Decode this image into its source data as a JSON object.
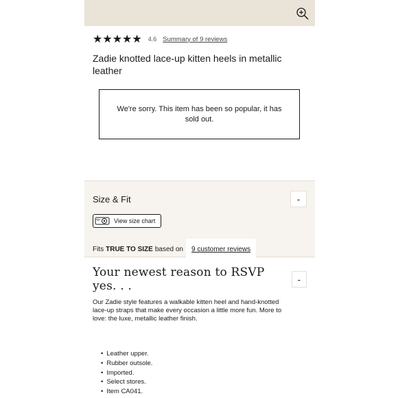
{
  "header": {
    "zoom_icon": "zoom-in-icon"
  },
  "rating": {
    "stars": "★★★★★",
    "value": "4.6",
    "summary_link": "Summary of 9 reviews"
  },
  "product": {
    "title": "Zadie knotted lace-up kitten heels in metallic leather",
    "soldout_message": "We're sorry. This item has been so popular, it has sold out."
  },
  "size_fit": {
    "title": "Size & Fit",
    "toggle": "-",
    "size_chart_label": "View size chart",
    "fits_prefix": "Fits",
    "fits_value": "TRUE TO SIZE",
    "fits_middle": "based on",
    "reviews_link": "9 customer reviews"
  },
  "description": {
    "title": "Your newest reason to RSVP yes. . .",
    "toggle": "-",
    "body": "Our Zadie style features a walkable kitten heel and hand-knotted lace-up straps that make every occasion a little more fun. More to love: the luxe, metallic leather finish.",
    "bullets": [
      "Leather upper.",
      "Rubber outsole.",
      "Imported.",
      "Select stores.",
      "Item CA041."
    ]
  }
}
